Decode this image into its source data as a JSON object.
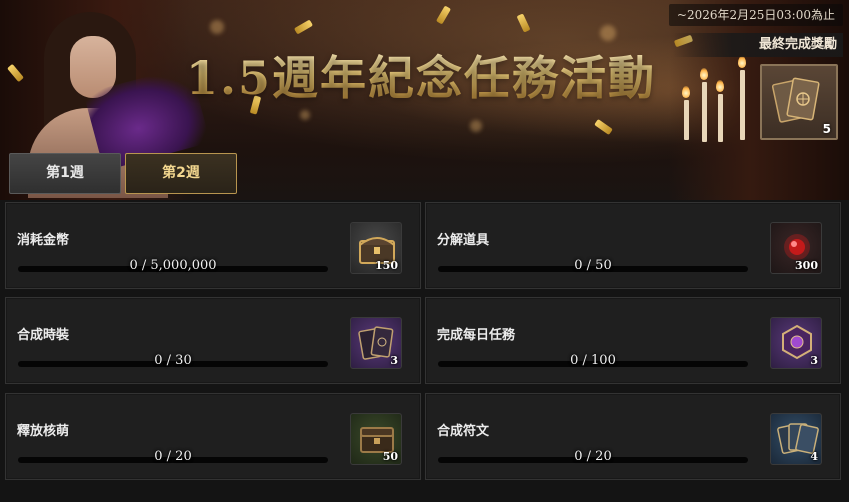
{
  "banner": {
    "title": "1.5週年紀念任務活動",
    "deadline": "~2026年2月25日03:00為止",
    "final_reward_label": "最終完成獎勵",
    "final_reward_qty": "5"
  },
  "tabs": [
    {
      "label": "第1週",
      "selected": false
    },
    {
      "label": "第2週",
      "selected": true
    }
  ],
  "missions": [
    {
      "name": "消耗金幣",
      "progress": "0 / 5,000,000",
      "reward_qty": "150",
      "reward_icon": "treasure-chest-icon"
    },
    {
      "name": "分解道具",
      "progress": "0 / 50",
      "reward_qty": "300",
      "reward_icon": "red-gem-icon"
    },
    {
      "name": "合成時裝",
      "progress": "0 / 30",
      "reward_qty": "3",
      "reward_icon": "purple-card-icon"
    },
    {
      "name": "完成每日任務",
      "progress": "0 / 100",
      "reward_qty": "3",
      "reward_icon": "purple-emblem-icon"
    },
    {
      "name": "釋放核萌",
      "progress": "0 / 20",
      "reward_qty": "50",
      "reward_icon": "green-chest-icon"
    },
    {
      "name": "合成符文",
      "progress": "0 / 20",
      "reward_qty": "4",
      "reward_icon": "blue-card-icon"
    }
  ],
  "colors": {
    "panel_bg": "#1f1f1f",
    "selected_tab_border": "#b8954f",
    "title_gold": "#e7c775"
  }
}
